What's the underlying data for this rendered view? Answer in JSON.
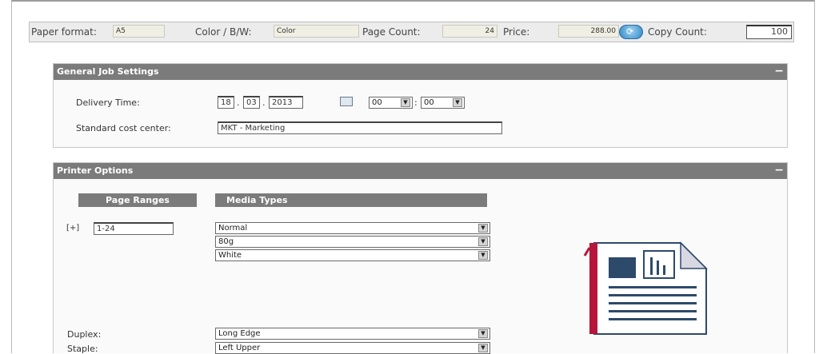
{
  "topbar": {
    "paper_format_label": "Paper format:",
    "paper_format_value": "A5",
    "color_label": "Color / B/W:",
    "color_value": "Color",
    "page_count_label": "Page Count:",
    "page_count_value": "24",
    "price_label": "Price:",
    "price_value": "288.00",
    "refresh_icon": "refresh-icon",
    "copy_count_label": "Copy Count:",
    "copy_count_value": "100"
  },
  "general": {
    "title": "General Job Settings",
    "collapse": "−",
    "delivery_label": "Delivery Time:",
    "day": "18",
    "month": "03",
    "year": "2013",
    "sep1": ".",
    "sep2": ".",
    "hour": "00",
    "minute": "00",
    "time_sep": ":",
    "calendar_icon": "calendar-icon",
    "cost_center_label": "Standard cost center:",
    "cost_center_value": "MKT - Marketing"
  },
  "printer": {
    "title": "Printer Options",
    "collapse": "−",
    "page_ranges_header": "Page Ranges",
    "media_types_header": "Media Types",
    "expand_label": "[+]",
    "page_range_value": "1-24",
    "media": [
      "Normal",
      "80g",
      "White"
    ],
    "duplex_label": "Duplex:",
    "duplex_value": "Long Edge",
    "staple_label": "Staple:",
    "staple_value": "Left Upper",
    "preview_icon": "document-preview-icon"
  },
  "colors": {
    "header_bg": "#7b7b7b",
    "accent_red": "#b5163a",
    "doc_blue": "#2d4a6b"
  }
}
